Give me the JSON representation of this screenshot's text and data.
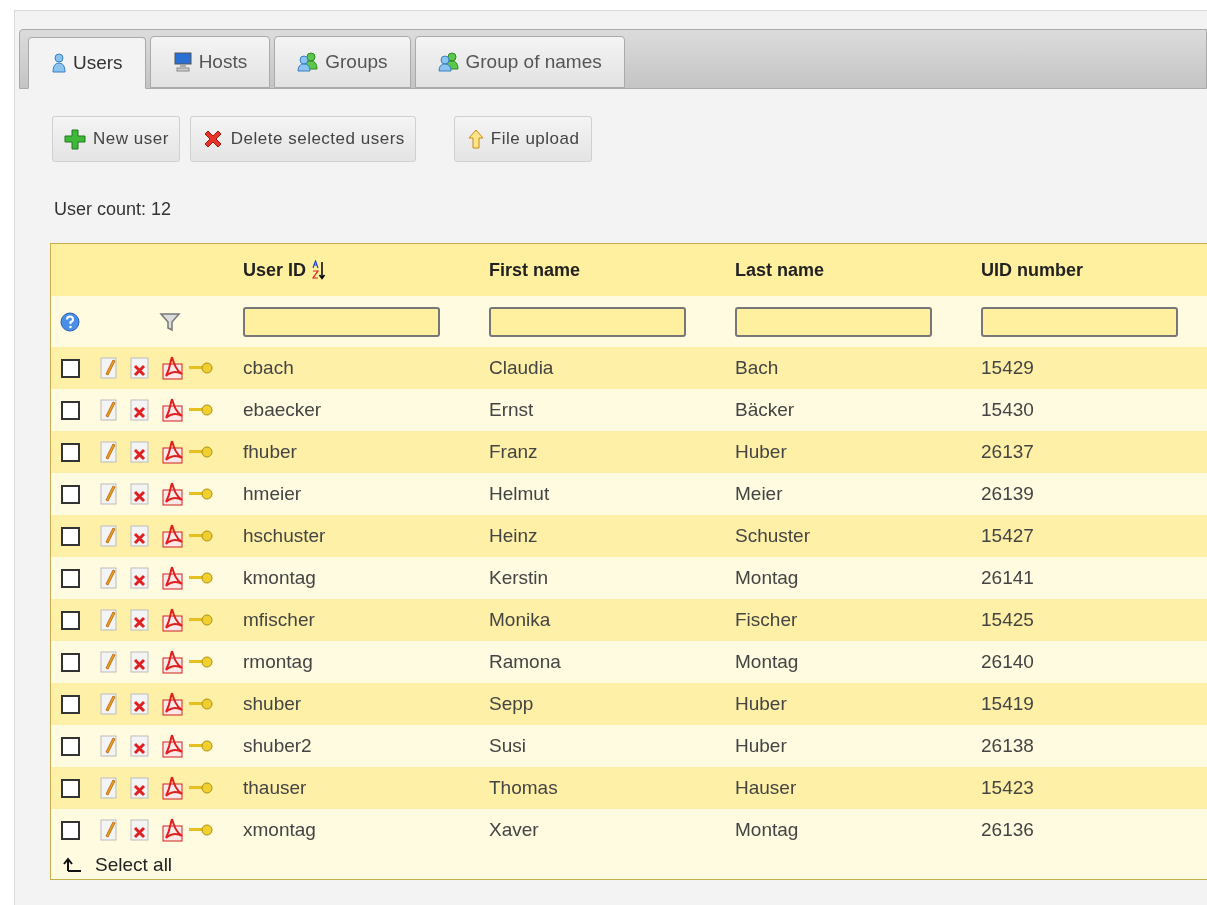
{
  "tabs": [
    {
      "label": "Users",
      "kind": "user",
      "selected": true
    },
    {
      "label": "Hosts",
      "kind": "host",
      "selected": false
    },
    {
      "label": "Groups",
      "kind": "group",
      "selected": false
    },
    {
      "label": "Group of names",
      "kind": "group",
      "selected": false
    }
  ],
  "toolbar": [
    {
      "label": "New user",
      "kind": "add"
    },
    {
      "label": "Delete selected users",
      "kind": "delete"
    },
    {
      "label": "File upload",
      "kind": "upload"
    }
  ],
  "user_count": "User count: 12",
  "table": {
    "columns": [
      {
        "label": "User ID",
        "sorted": true
      },
      {
        "label": "First name",
        "sorted": false
      },
      {
        "label": "Last name",
        "sorted": false
      },
      {
        "label": "UID number",
        "sorted": false
      }
    ],
    "rows": [
      {
        "checked": false,
        "cells": [
          "cbach",
          "Claudia",
          "Bach",
          "15429"
        ]
      },
      {
        "checked": false,
        "cells": [
          "ebaecker",
          "Ernst",
          "Bäcker",
          "15430"
        ]
      },
      {
        "checked": false,
        "cells": [
          "fhuber",
          "Franz",
          "Huber",
          "26137"
        ]
      },
      {
        "checked": false,
        "cells": [
          "hmeier",
          "Helmut",
          "Meier",
          "26139"
        ]
      },
      {
        "checked": false,
        "cells": [
          "hschuster",
          "Heinz",
          "Schuster",
          "15427"
        ]
      },
      {
        "checked": false,
        "cells": [
          "kmontag",
          "Kerstin",
          "Montag",
          "26141"
        ]
      },
      {
        "checked": false,
        "cells": [
          "mfischer",
          "Monika",
          "Fischer",
          "15425"
        ]
      },
      {
        "checked": false,
        "cells": [
          "rmontag",
          "Ramona",
          "Montag",
          "26140"
        ]
      },
      {
        "checked": false,
        "cells": [
          "shuber",
          "Sepp",
          "Huber",
          "15419"
        ]
      },
      {
        "checked": false,
        "cells": [
          "shuber2",
          "Susi",
          "Huber",
          "26138"
        ]
      },
      {
        "checked": false,
        "cells": [
          "thauser",
          "Thomas",
          "Hauser",
          "15423"
        ]
      },
      {
        "checked": false,
        "cells": [
          "xmontag",
          "Xaver",
          "Montag",
          "26136"
        ]
      }
    ],
    "select_all": "Select all"
  }
}
